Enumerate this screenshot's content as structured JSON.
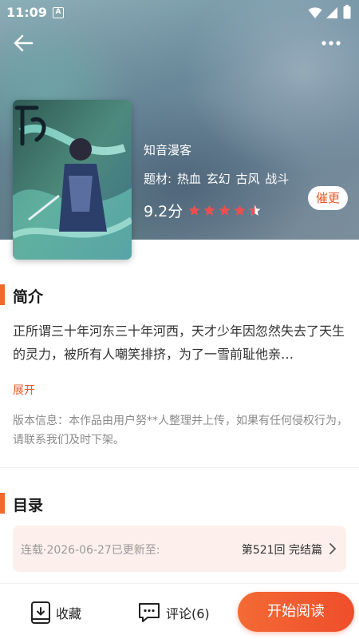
{
  "status_bar": {
    "time": "11:09",
    "notification_icon": "A"
  },
  "header": {
    "back_icon": "arrow-left-icon",
    "more_icon": "more-dots-icon"
  },
  "book": {
    "author": "知音漫客",
    "genres_label": "题材:",
    "genres": [
      "热血",
      "玄幻",
      "古风",
      "战斗"
    ],
    "score": "9.2分",
    "stars": 4.5,
    "urge_label": "催更"
  },
  "intro": {
    "title": "简介",
    "text": "正所谓三十年河东三十年河西，天才少年因忽然失去了天生的灵力，被所有人嘲笑排挤，为了一雪前耻他亲…",
    "expand_label": "展开",
    "copyright": "版本信息：本作品由用户努**人整理并上传，如果有任何侵权行为，请联系我们及时下架。"
  },
  "catalog": {
    "title": "目录",
    "status": "连载·2026-06-27已更新至:",
    "latest": "第521回 完结篇"
  },
  "bottom": {
    "favorite_label": "收藏",
    "comment_label": "评论(6)",
    "read_label": "开始阅读"
  },
  "colors": {
    "accent": "#f06a2b",
    "star": "#ef4e4e"
  }
}
